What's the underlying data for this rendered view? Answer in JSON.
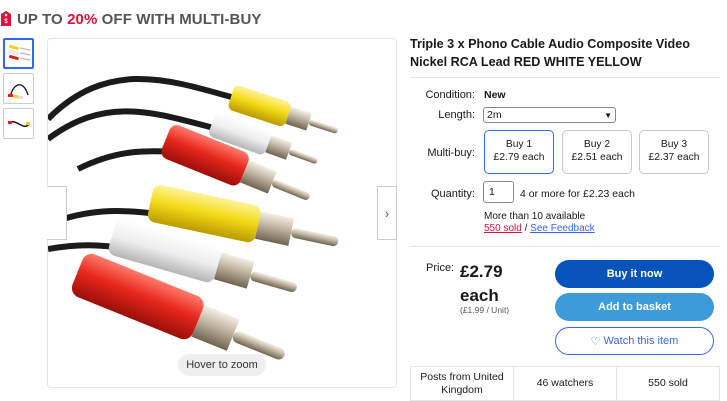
{
  "promo": {
    "prefix": "UP TO ",
    "percent": "20%",
    "suffix": " OFF WITH MULTI-BUY",
    "accent": "#e0103a"
  },
  "gallery": {
    "thumbnails": [
      "rca-cable-thumb-1",
      "rca-cable-thumb-2",
      "rca-cable-thumb-3"
    ],
    "hover_label": "Hover to zoom"
  },
  "listing": {
    "title": "Triple 3 x Phono Cable Audio Composite Video Nickel RCA Lead RED WHITE YELLOW",
    "condition_label": "Condition:",
    "condition_value": "New",
    "length_label": "Length:",
    "length_value": "2m",
    "multibuy_label": "Multi-buy:",
    "multibuy_options": [
      {
        "qty": "Buy 1",
        "price": "£2.79 each"
      },
      {
        "qty": "Buy 2",
        "price": "£2.51 each"
      },
      {
        "qty": "Buy 3",
        "price": "£2.37 each"
      }
    ],
    "quantity_label": "Quantity:",
    "quantity_value": "1",
    "quantity_note": "4 or more for £2.23 each",
    "availability": "More than 10 available",
    "sold": "550 sold",
    "sold_separator": " / ",
    "feedback": "See Feedback",
    "price_label": "Price:",
    "price": "£2.79 each",
    "unit_price": "(£1.99 / Unit)"
  },
  "actions": {
    "buy_now": "Buy it now",
    "add_basket": "Add to basket",
    "watch": "Watch this item"
  },
  "stats": {
    "location": "Posts from United Kingdom",
    "watchers": "46 watchers",
    "sold": "550 sold"
  },
  "colors": {
    "primary_blue": "#0654ba",
    "light_blue": "#3d9bd8",
    "link_blue": "#3665f3",
    "sold_red": "#e0103a"
  }
}
